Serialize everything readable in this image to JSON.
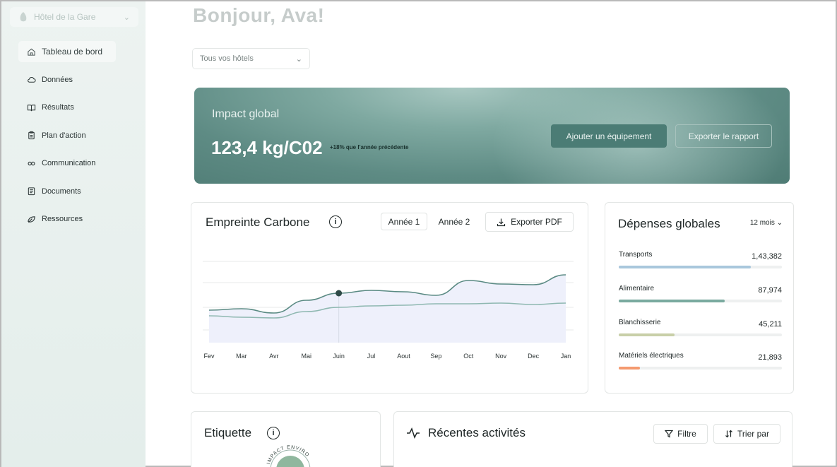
{
  "sidebar": {
    "hotel_name": "Hôtel de la Gare",
    "items": [
      {
        "label": "Tableau de bord",
        "icon": "home-icon"
      },
      {
        "label": "Données",
        "icon": "cloud-icon"
      },
      {
        "label": "Résultats",
        "icon": "book-icon"
      },
      {
        "label": "Plan d'action",
        "icon": "clipboard-icon"
      },
      {
        "label": "Communication",
        "icon": "link-icon"
      },
      {
        "label": "Documents",
        "icon": "document-icon"
      },
      {
        "label": "Ressources",
        "icon": "resources-icon"
      }
    ]
  },
  "header": {
    "greeting": "Bonjour, Ava!",
    "hotels_filter": "Tous vos hôtels"
  },
  "banner": {
    "title": "Impact global",
    "value": "123,4 kg/C02",
    "delta": "+18% que l'année précédente",
    "add_button": "Ajouter un équipement",
    "export_button": "Exporter le rapport"
  },
  "carbon": {
    "title": "Empreinte Carbone",
    "year1": "Année 1",
    "year2": "Année 2",
    "export_pdf": "Exporter PDF"
  },
  "chart_data": {
    "type": "line",
    "x": [
      "Fev",
      "Mar",
      "Avr",
      "Mai",
      "Juin",
      "Jul",
      "Aout",
      "Sep",
      "Oct",
      "Nov",
      "Dec",
      "Jan"
    ],
    "series": [
      {
        "values": [
          46,
          48,
          42,
          60,
          70,
          74,
          72,
          67,
          88,
          83,
          82,
          96
        ]
      },
      {
        "values": [
          38,
          36,
          35,
          44,
          50,
          52,
          53,
          55,
          55,
          56,
          54,
          56
        ]
      }
    ],
    "ylim": [
      0,
      130
    ],
    "grid": true,
    "highlight_index": 4,
    "colors": {
      "line1": "#5a8a83",
      "line2": "#8fb8b1",
      "area": "#eef0fb",
      "grid": "#e7e9e9"
    }
  },
  "spending": {
    "title": "Dépenses globales",
    "period": "12 mois",
    "items": [
      {
        "label": "Transports",
        "value": "1,43,382",
        "fraction": 0.81,
        "color": "#a9c7dc"
      },
      {
        "label": "Alimentaire",
        "value": "87,974",
        "fraction": 0.65,
        "color": "#7aaa9f"
      },
      {
        "label": "Blanchisserie",
        "value": "45,211",
        "fraction": 0.34,
        "color": "#c8cfa8"
      },
      {
        "label": "Matériels électriques",
        "value": "21,893",
        "fraction": 0.13,
        "color": "#f49a6f"
      }
    ]
  },
  "label_card": {
    "title": "Etiquette",
    "badge_text": "IMPACT ENVIRO"
  },
  "activity": {
    "title": "Récentes activités",
    "filter": "Filtre",
    "sort": "Trier par"
  }
}
